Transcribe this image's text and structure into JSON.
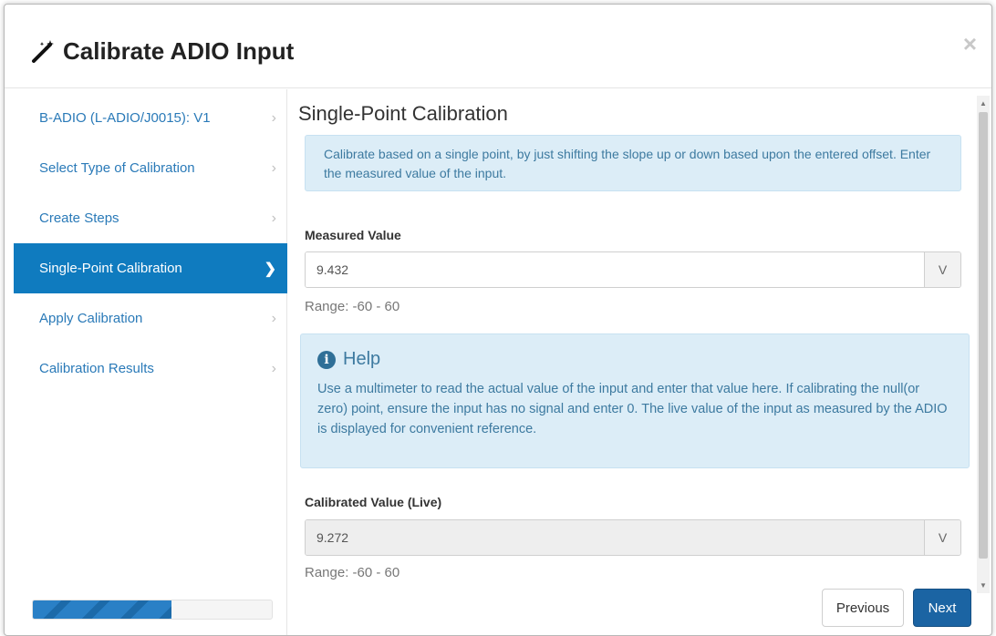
{
  "dialog": {
    "title": "Calibrate ADIO Input",
    "close_label": "×"
  },
  "sidebar": {
    "items": [
      {
        "label": "B-ADIO (L-ADIO/J0015): V1",
        "active": false
      },
      {
        "label": "Select Type of Calibration",
        "active": false
      },
      {
        "label": "Create Steps",
        "active": false
      },
      {
        "label": "Single-Point Calibration",
        "active": true
      },
      {
        "label": "Apply Calibration",
        "active": false
      },
      {
        "label": "Calibration Results",
        "active": false
      }
    ],
    "progress_fraction": 0.58
  },
  "main": {
    "section_title": "Single-Point Calibration",
    "info_text": "Calibrate based on a single point, by just shifting the slope up or down based upon the entered offset. Enter the measured value of the input.",
    "measured": {
      "label": "Measured Value",
      "value": "9.432",
      "unit": "V",
      "range": "Range: -60 - 60"
    },
    "help": {
      "title": "Help",
      "icon_glyph": "i",
      "text": "Use a multimeter to read the actual value of the input and enter that value here. If calibrating the null(or zero) point, ensure the input has no signal and enter 0. The live value of the input as measured by the ADIO is displayed for convenient reference."
    },
    "calibrated": {
      "label": "Calibrated Value (Live)",
      "value": "9.272",
      "unit": "V",
      "range": "Range: -60 - 60"
    }
  },
  "footer": {
    "previous_label": "Previous",
    "next_label": "Next"
  },
  "colors": {
    "accent": "#0f7bbf",
    "info_bg": "#dcedf7",
    "next_button": "#1b64a3"
  }
}
